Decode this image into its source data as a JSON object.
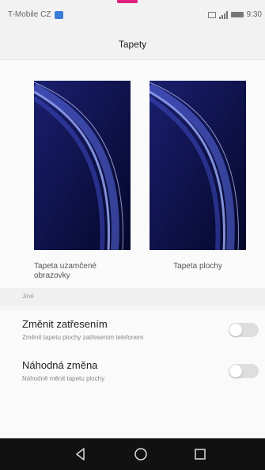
{
  "status_bar": {
    "carrier": "T-Mobile CZ",
    "time": "9:30",
    "icons": [
      "notification-icon",
      "sim-icon",
      "signal-icon",
      "battery-icon"
    ]
  },
  "header": {
    "title": "Tapety"
  },
  "wallpapers": {
    "lock": {
      "label": "Tapeta uzamčené obrazovky"
    },
    "home": {
      "label": "Tapeta plochy"
    }
  },
  "section": {
    "label": "Jiné"
  },
  "settings": [
    {
      "title": "Změnit zatřesením",
      "subtitle": "Změnit tapetu plochy zatřesením telefonem",
      "enabled": false
    },
    {
      "title": "Náhodná změna",
      "subtitle": "Náhodně měnit tapetu plochy",
      "enabled": false
    }
  ],
  "nav": {
    "icons": [
      "back-icon",
      "home-icon",
      "recent-apps-icon"
    ]
  },
  "colors": {
    "accent": "#e0217a",
    "nav_bar": "#111111",
    "toggle_off": "#dedede",
    "wallpaper_bg": "#0a0e3a"
  }
}
